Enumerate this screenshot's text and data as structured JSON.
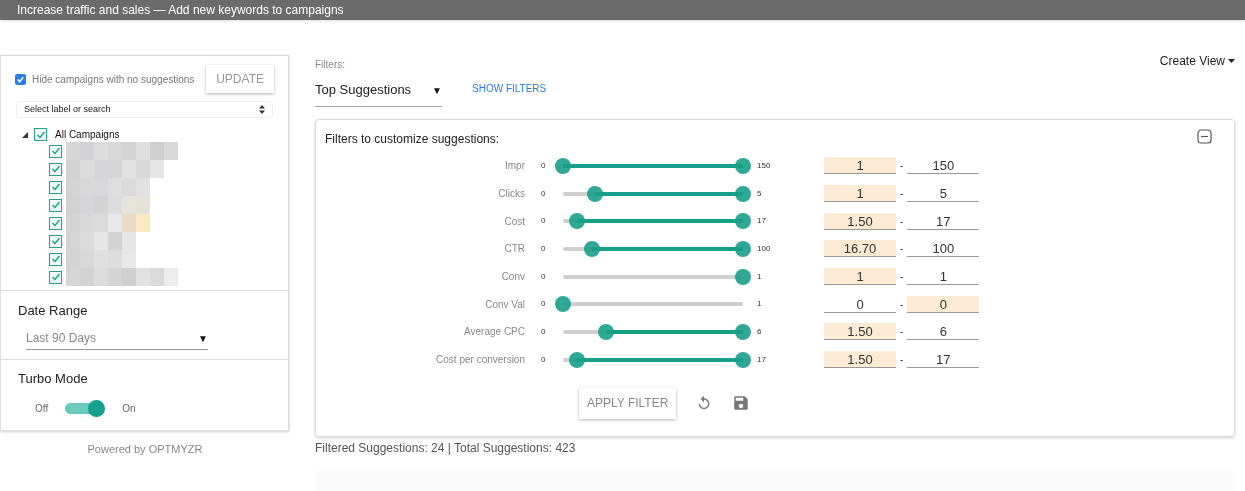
{
  "header": {
    "title": "Increase traffic and sales — Add new keywords to campaigns"
  },
  "sidebar": {
    "hide_empty": {
      "label": "Hide campaigns with no suggestions",
      "checked": true
    },
    "update_button": "UPDATE",
    "label_select": {
      "placeholder": "Select label or search"
    },
    "tree": {
      "label": "All Campaigns",
      "checked": true,
      "expanded": true,
      "children": [
        {
          "checked": true
        },
        {
          "checked": true
        },
        {
          "checked": true
        },
        {
          "checked": true
        },
        {
          "checked": true
        },
        {
          "checked": true
        },
        {
          "checked": true
        },
        {
          "checked": true
        }
      ]
    },
    "date_range": {
      "title": "Date Range",
      "value": "Last 90 Days",
      "caret": "▼"
    },
    "turbo_mode": {
      "title": "Turbo Mode",
      "off_label": "Off",
      "on_label": "On",
      "on": true
    },
    "footer": "Powered by OPTMYZR"
  },
  "filters_label": "Filters:",
  "filter_select": {
    "value": "Top Suggestions",
    "caret": "▼"
  },
  "show_filters": "SHOW FILTERS",
  "create_view": "Create View",
  "filter_panel": {
    "title": "Filters to customize suggestions:",
    "rows": [
      {
        "label": "Impr",
        "min_label": "0",
        "max_label": "150",
        "thumbs": [
          {
            "level": 0
          },
          {
            "level": 1
          }
        ],
        "min": {
          "value": "1",
          "highlighted": true
        },
        "max": {
          "value": "150",
          "highlighted": false
        }
      },
      {
        "label": "Clicks",
        "min_label": "0",
        "max_label": "5",
        "thumbs": [
          {
            "level": 0.18
          },
          {
            "level": 1
          }
        ],
        "min": {
          "value": "1",
          "highlighted": true
        },
        "max": {
          "value": "5",
          "highlighted": false
        }
      },
      {
        "label": "Cost",
        "min_label": "0",
        "max_label": "17",
        "thumbs": [
          {
            "level": 0.08
          },
          {
            "level": 1
          }
        ],
        "min": {
          "value": "1.50",
          "highlighted": true
        },
        "max": {
          "value": "17",
          "highlighted": false
        }
      },
      {
        "label": "CTR",
        "min_label": "0",
        "max_label": "100",
        "thumbs": [
          {
            "level": 0.16
          },
          {
            "level": 1
          }
        ],
        "min": {
          "value": "16.70",
          "highlighted": true
        },
        "max": {
          "value": "100",
          "highlighted": false
        }
      },
      {
        "label": "Conv",
        "min_label": "0",
        "max_label": "1",
        "thumbs": [
          {
            "level": 1
          }
        ],
        "min": {
          "value": "1",
          "highlighted": true
        },
        "max": {
          "value": "1",
          "highlighted": false
        }
      },
      {
        "label": "Conv Val",
        "min_label": "0",
        "max_label": "1",
        "thumbs": [
          {
            "level": 0
          }
        ],
        "min": {
          "value": "0",
          "highlighted": false
        },
        "max": {
          "value": "0",
          "highlighted": true
        }
      },
      {
        "label": "Average CPC",
        "min_label": "0",
        "max_label": "6",
        "thumbs": [
          {
            "level": 0.24
          },
          {
            "level": 1
          }
        ],
        "min": {
          "value": "1.50",
          "highlighted": true
        },
        "max": {
          "value": "6",
          "highlighted": false
        }
      },
      {
        "label": "Cost per conversion",
        "min_label": "0",
        "max_label": "17",
        "thumbs": [
          {
            "level": 0.08
          },
          {
            "level": 1
          }
        ],
        "min": {
          "value": "1.50",
          "highlighted": true
        },
        "max": {
          "value": "17",
          "highlighted": false
        }
      }
    ],
    "separator": "-",
    "apply_button": "APPLY FILTER"
  },
  "summary": "Filtered Suggestions: 24 | Total Suggestions: 423"
}
